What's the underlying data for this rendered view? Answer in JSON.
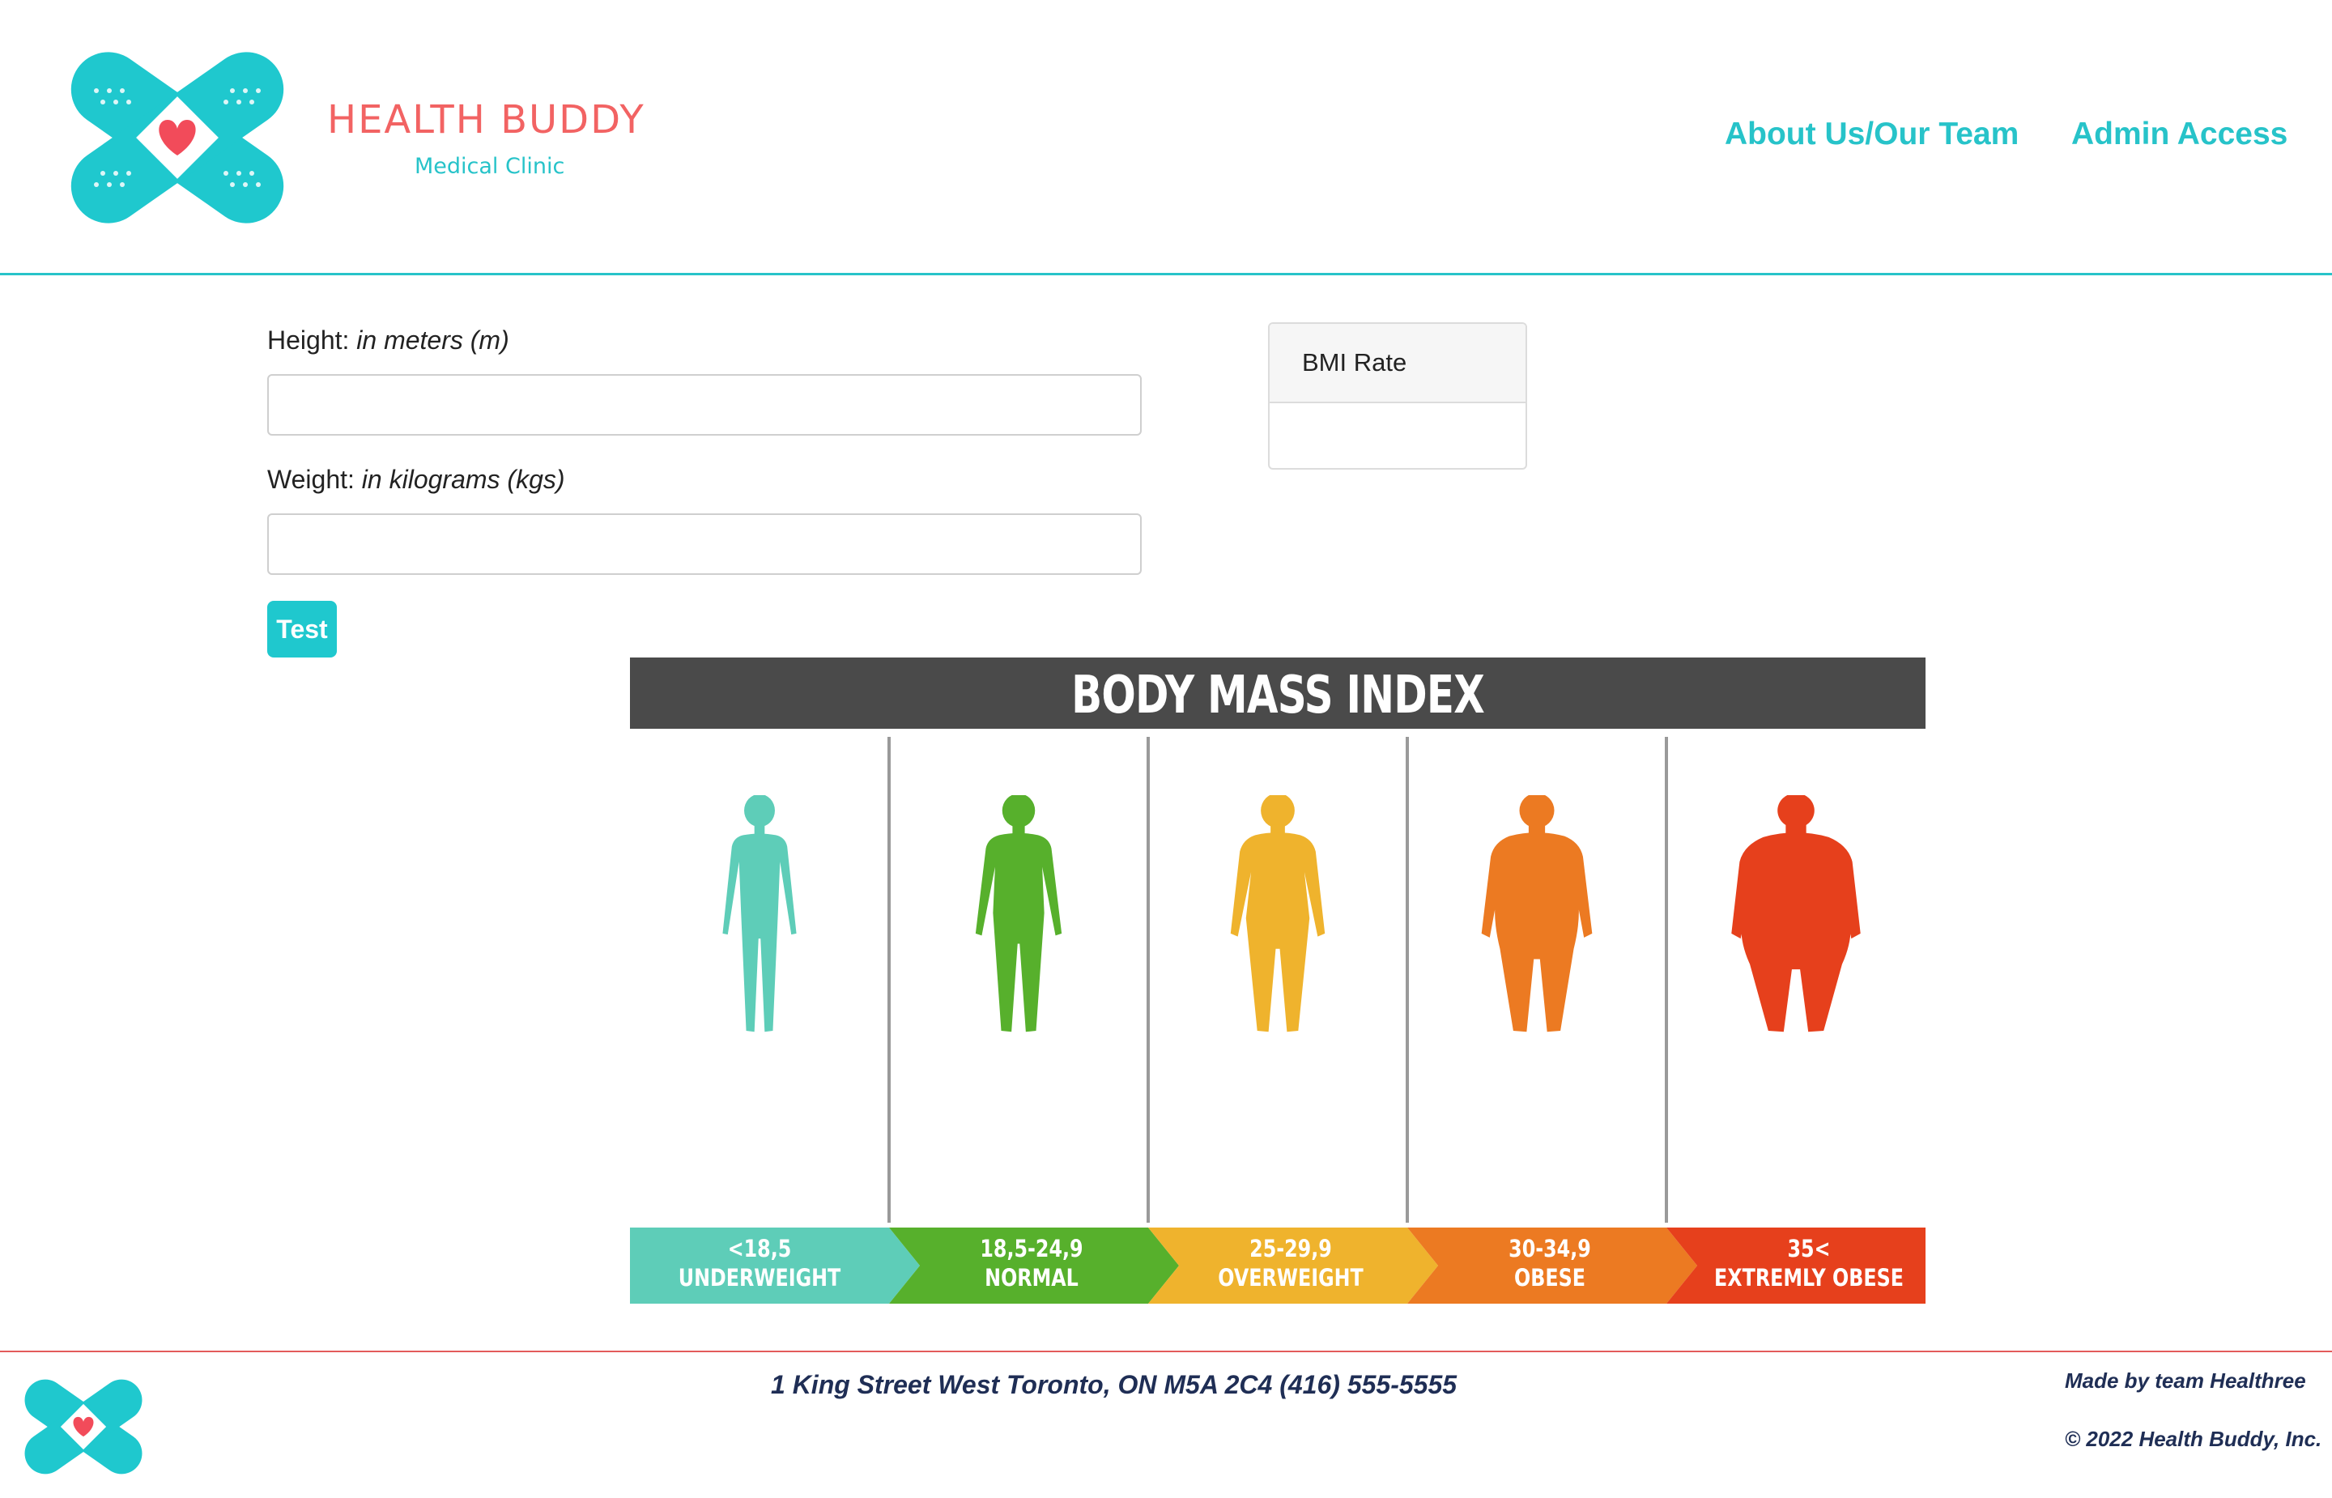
{
  "header": {
    "logo_icon": "bandage-heart-icon",
    "brand_title": "HEALTH BUDDY",
    "brand_subtitle": "Medical Clinic",
    "nav": {
      "about": "About Us/Our Team",
      "admin": "Admin Access"
    }
  },
  "form": {
    "height_label": "Height:",
    "height_hint": "in meters (m)",
    "height_value": "",
    "weight_label": "Weight:",
    "weight_hint": "in kilograms (kgs)",
    "weight_value": "",
    "test_button": "Test"
  },
  "bmi_card": {
    "title": "BMI Rate",
    "value": ""
  },
  "bmi_chart": {
    "title": "BODY MASS INDEX",
    "categories": [
      {
        "range": "<18,5",
        "name": "UNDERWEIGHT",
        "color": "#5ecdb8"
      },
      {
        "range": "18,5-24,9",
        "name": "NORMAL",
        "color": "#57b02c"
      },
      {
        "range": "25-29,9",
        "name": "OVERWEIGHT",
        "color": "#efb32d"
      },
      {
        "range": "30-34,9",
        "name": "OBESE",
        "color": "#ec7a22"
      },
      {
        "range": "35<",
        "name": "EXTREMLY OBESE",
        "color": "#e6401c"
      }
    ]
  },
  "footer": {
    "address": "1 King Street West Toronto, ON M5A 2C4 (416) 555-5555",
    "made_by": "Made by team Healthree",
    "copyright": "© 2022 Health Buddy, Inc."
  },
  "colors": {
    "accent": "#27c3c9",
    "brand_red": "#f26363",
    "footer_text": "#1f2e55"
  }
}
